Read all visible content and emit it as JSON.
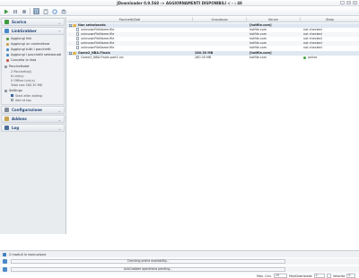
{
  "window": {
    "title": "JDownloader 0.9.568 -> AGGIORNAMENTI DISPONIBILI < - : 48",
    "buttons": [
      "_",
      "□",
      "×"
    ]
  },
  "toolbar": {
    "icons": [
      "play-icon",
      "pause-icon",
      "stop-icon",
      "add-icon",
      "clipboard-icon",
      "reconnect-icon",
      "update-icon"
    ]
  },
  "sidebar": {
    "panels": [
      {
        "label": "Scarica",
        "expanded": false
      },
      {
        "label": "LinkGrabber",
        "expanded": true
      },
      {
        "label": "Configurazione",
        "expanded": false
      },
      {
        "label": "Addons",
        "expanded": false
      },
      {
        "label": "Log",
        "expanded": false
      }
    ],
    "linkgrabber_items": [
      "Aggiungi link",
      "Aggiungi un contenitore",
      "Aggiungi tutti i pacchetti",
      "Aggiungi i pacchetti selezionati",
      "Cancella la lista"
    ],
    "package_group_label": "Pacchettotot",
    "package_stats": [
      "2 Pacchetto(i)",
      "6 Link(s)",
      "0 Offline Link(s)",
      "Total size 280.30 MB"
    ],
    "settings_group_label": "Settings",
    "settings_options": [
      {
        "label": "Start after adding",
        "checked": true
      },
      {
        "label": "Add at top",
        "checked": false
      }
    ]
  },
  "table": {
    "columns": [
      "Pacchetti/Dati",
      "Grandezza",
      "Server",
      "Stato"
    ],
    "rows": [
      {
        "type": "package",
        "name": "Non selezionato",
        "size": "",
        "host": "[hotfile.com]",
        "status": ""
      },
      {
        "type": "file",
        "name": "unknownFileName.file",
        "size": "",
        "host": "hotfile.com",
        "status": "not checked"
      },
      {
        "type": "file",
        "name": "unknownFileName.file",
        "size": "",
        "host": "hotfile.com",
        "status": "not checked"
      },
      {
        "type": "file",
        "name": "unknownFileName.file",
        "size": "",
        "host": "hotfile.com",
        "status": "not checked"
      },
      {
        "type": "file",
        "name": "unknownFileName.file",
        "size": "",
        "host": "hotfile.com",
        "status": "not checked"
      },
      {
        "type": "file",
        "name": "unknownFileName.file",
        "size": "",
        "host": "hotfile.com",
        "status": "not checked"
      },
      {
        "type": "package",
        "name": "Game2_NBA.Finals",
        "size": "280.30 MB",
        "host": "[hotfile.com]",
        "status": ""
      },
      {
        "type": "file",
        "name": "Game2_NBA.Finals.part1.rar",
        "size": "280.30 MB",
        "host": "hotfile.com",
        "status": "online"
      }
    ]
  },
  "status": {
    "modules_text": "2 moduli in esecuzione",
    "progress1_text": "Checking online availability...",
    "progress1_fraction": 0.0,
    "progress2_text": "LinkGrabber operations pending...",
    "progress2_fraction": 0.0,
    "max_conn_label": "Max. Con.",
    "max_conn_value": "15",
    "max_downloads_label": "MaxDownloads",
    "max_downloads_value": "2",
    "speed_label": "Velocità",
    "speed_value": "0"
  },
  "colors": {
    "accent": "#2a4b7a",
    "online": "#3aa63a",
    "package_row": "#dfe8f2"
  }
}
